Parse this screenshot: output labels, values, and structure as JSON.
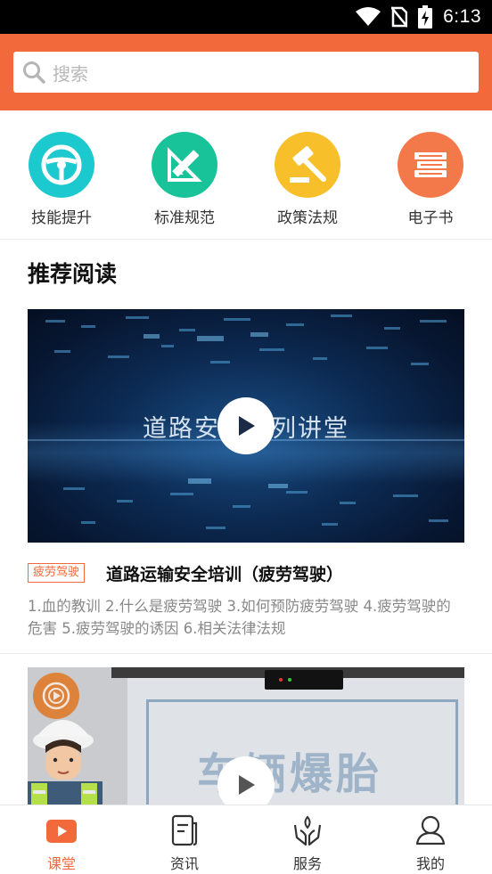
{
  "status_bar": {
    "time": "6:13"
  },
  "search": {
    "placeholder": "搜索"
  },
  "categories": [
    {
      "label": "技能提升",
      "icon": "steering-wheel-icon",
      "color": "#1cc9cf"
    },
    {
      "label": "标准规范",
      "icon": "ruler-triangle-icon",
      "color": "#18c39a"
    },
    {
      "label": "政策法规",
      "icon": "gavel-icon",
      "color": "#f7bf2a"
    },
    {
      "label": "电子书",
      "icon": "books-icon",
      "color": "#f4794a"
    }
  ],
  "section": {
    "title": "推荐阅读"
  },
  "articles": [
    {
      "video_caption": "道路安全系列讲堂",
      "tag": "疲劳驾驶",
      "title": "道路运输安全培训（疲劳驾驶）",
      "description": "1.血的教训 2.什么是疲劳驾驶 3.如何预防疲劳驾驶 4.疲劳驾驶的危害 5.疲劳驾驶的诱因 6.相关法律法规"
    },
    {
      "video_caption": "车辆爆胎"
    }
  ],
  "bottom_nav": [
    {
      "label": "课堂",
      "icon": "play-tv-icon",
      "active": true
    },
    {
      "label": "资讯",
      "icon": "document-icon",
      "active": false
    },
    {
      "label": "服务",
      "icon": "hands-service-icon",
      "active": false
    },
    {
      "label": "我的",
      "icon": "user-icon",
      "active": false
    }
  ],
  "colors": {
    "accent": "#f26a3c"
  }
}
